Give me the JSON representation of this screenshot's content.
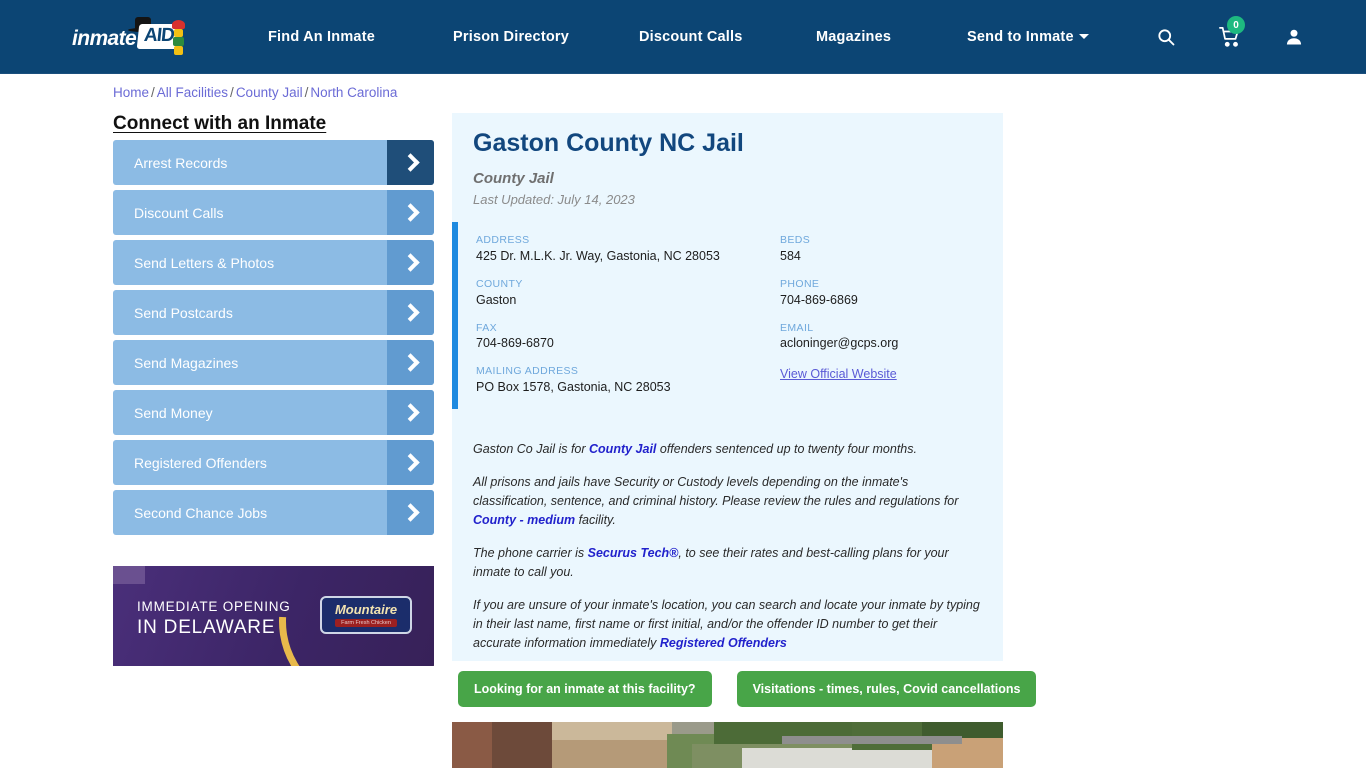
{
  "header": {
    "logo": {
      "text": "inmate",
      "badge": "AID",
      "alt": "inmateAID logo"
    },
    "nav": [
      {
        "label": "Find An Inmate",
        "has_caret": false
      },
      {
        "label": "Prison Directory",
        "has_caret": false
      },
      {
        "label": "Discount Calls",
        "has_caret": false
      },
      {
        "label": "Magazines",
        "has_caret": false
      },
      {
        "label": "Send to Inmate",
        "has_caret": true
      }
    ],
    "icons": {
      "search": "search-icon",
      "cart": "shopping-cart-icon",
      "cart_count": "0",
      "account": "user-account-icon"
    }
  },
  "breadcrumb": {
    "items": [
      "Home",
      "All Facilities",
      "County Jail",
      "North Carolina"
    ],
    "separator": "/"
  },
  "sidebar": {
    "title": "Connect with an Inmate",
    "items": [
      {
        "label": "Arrest Records",
        "active": true
      },
      {
        "label": "Discount Calls",
        "active": false
      },
      {
        "label": "Send Letters & Photos",
        "active": false
      },
      {
        "label": "Send Postcards",
        "active": false
      },
      {
        "label": "Send Magazines",
        "active": false
      },
      {
        "label": "Send Money",
        "active": false
      },
      {
        "label": "Registered Offenders",
        "active": false
      },
      {
        "label": "Second Chance Jobs",
        "active": false
      }
    ],
    "ad": {
      "line1": "IMMEDIATE OPENING",
      "line2": "IN DELAWARE",
      "brand": "Mountaire",
      "brand_sub": "Farm Fresh Chicken"
    }
  },
  "facility": {
    "title": "Gaston County NC Jail",
    "subtitle": "County Jail",
    "last_updated": "Last Updated: July 14, 2023",
    "info_left": [
      {
        "label": "ADDRESS",
        "value": "425 Dr. M.L.K. Jr. Way, Gastonia, NC 28053"
      },
      {
        "label": "COUNTY",
        "value": "Gaston"
      },
      {
        "label": "FAX",
        "value": "704-869-6870"
      },
      {
        "label": "MAILING ADDRESS",
        "value": "PO Box 1578, Gastonia, NC 28053"
      }
    ],
    "info_right": [
      {
        "label": "BEDS",
        "value": "584"
      },
      {
        "label": "PHONE",
        "value": "704-869-6869"
      },
      {
        "label": "EMAIL",
        "value": "acloninger@gcps.org"
      }
    ],
    "website_link": "View Official Website",
    "paragraphs": [
      {
        "parts": [
          {
            "t": "Gaston Co Jail is for ",
            "link": false
          },
          {
            "t": "County Jail",
            "link": true
          },
          {
            "t": " offenders sentenced up to twenty four months.",
            "link": false
          }
        ]
      },
      {
        "parts": [
          {
            "t": "All prisons and jails have Security or Custody levels depending on the inmate's classification, sentence, and criminal history. Please review the rules and regulations for ",
            "link": false
          },
          {
            "t": "County - medium",
            "link": true
          },
          {
            "t": " facility.",
            "link": false
          }
        ]
      },
      {
        "parts": [
          {
            "t": "The phone carrier is ",
            "link": false
          },
          {
            "t": "Securus Tech®",
            "link": true
          },
          {
            "t": ", to see their rates and best-calling plans for your inmate to call you.",
            "link": false
          }
        ]
      },
      {
        "parts": [
          {
            "t": "If you are unsure of your inmate's location, you can search and locate your inmate by typing in their last name, first name or first initial, and/or the offender ID number to get their accurate information immediately ",
            "link": false
          },
          {
            "t": "Registered Offenders",
            "link": true
          }
        ]
      }
    ],
    "buttons": [
      {
        "label": "Looking for an inmate at this facility?"
      },
      {
        "label": "Visitations - times, rules, Covid cancellations"
      }
    ],
    "photo_alt": "aerial-photo-of-facility"
  },
  "colors": {
    "header_navy": "#0c4574",
    "panel_bg": "#ebf7fe",
    "accent_blue": "#1e8ae0",
    "sidebar_blue": "#8cbbe4",
    "sidebar_arrow": "#619bd0",
    "sidebar_arrow_active": "#1f4e79",
    "green_button": "#48a548",
    "badge_green": "#1eb980",
    "title_navy": "#12477e",
    "link_purple": "#6b6bd6",
    "link_blue": "#2222cc"
  }
}
